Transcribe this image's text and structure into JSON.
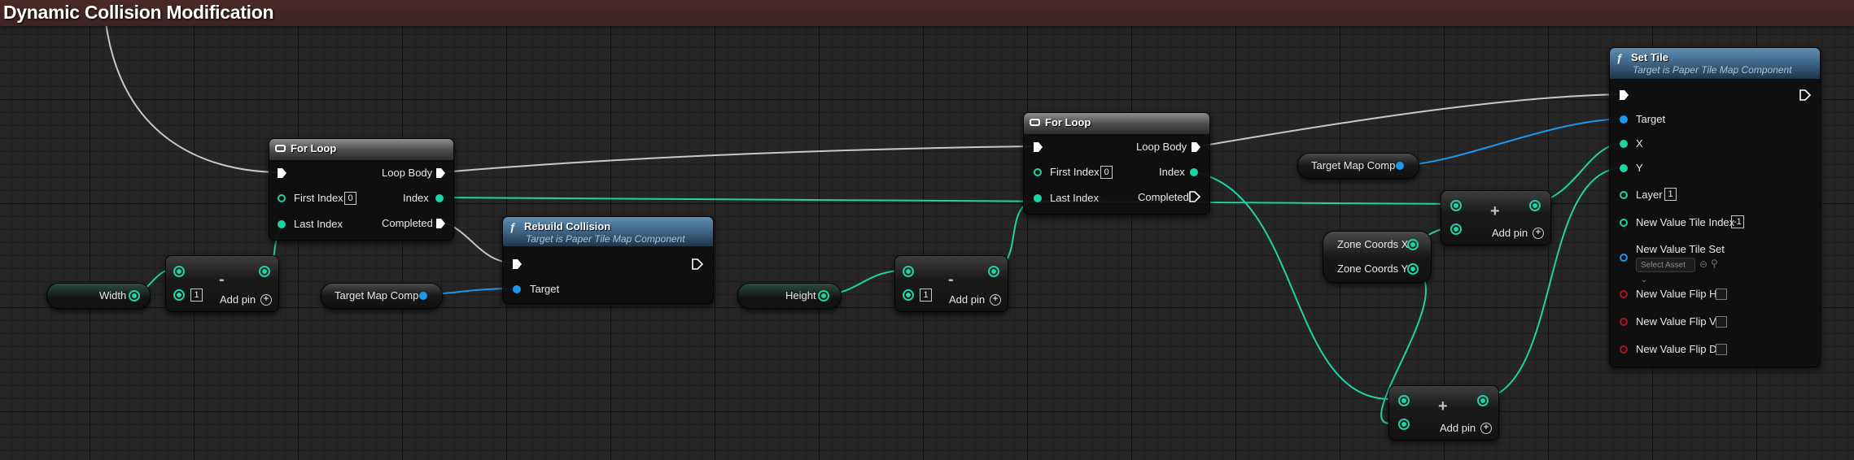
{
  "graph": {
    "title": "Dynamic Collision Modification"
  },
  "nodes": {
    "width_var": {
      "label": "Width"
    },
    "height_var": {
      "label": "Height"
    },
    "target_map_comp_1": {
      "label": "Target Map Comp"
    },
    "target_map_comp_2": {
      "label": "Target Map Comp"
    },
    "zone_coords": {
      "x_label": "Zone Coords X",
      "y_label": "Zone Coords Y"
    },
    "subtract_1": {
      "symbol": "-",
      "value": "1",
      "add_pin": "Add pin"
    },
    "subtract_2": {
      "symbol": "-",
      "value": "1",
      "add_pin": "Add pin"
    },
    "add_1": {
      "symbol": "+",
      "add_pin": "Add pin"
    },
    "add_2": {
      "symbol": "+",
      "add_pin": "Add pin"
    },
    "for_loop_1": {
      "title": "For Loop",
      "loop_body": "Loop Body",
      "first_index": "First Index",
      "first_index_value": "0",
      "index": "Index",
      "last_index": "Last Index",
      "completed": "Completed"
    },
    "for_loop_2": {
      "title": "For Loop",
      "loop_body": "Loop Body",
      "first_index": "First Index",
      "first_index_value": "0",
      "index": "Index",
      "last_index": "Last Index",
      "completed": "Completed"
    },
    "rebuild_collision": {
      "title": "Rebuild Collision",
      "subtitle": "Target is Paper Tile Map Component",
      "target": "Target"
    },
    "set_tile": {
      "title": "Set Tile",
      "subtitle": "Target is Paper Tile Map Component",
      "target": "Target",
      "x": "X",
      "y": "Y",
      "layer": "Layer",
      "layer_value": "1",
      "tile_index": "New Value Tile Index",
      "tile_index_value": "-1",
      "tile_set": "New Value Tile Set",
      "select_asset": "Select Asset",
      "flip_h": "New Value Flip H",
      "flip_v": "New Value Flip V",
      "flip_d": "New Value Flip D"
    }
  },
  "colors": {
    "exec": "#ffffff",
    "integer": "#1fd3a4",
    "object": "#1c97ec",
    "boolean": "#a8161a",
    "header_bar": "#4a2a26",
    "function_header": "#3a5f80"
  },
  "icons": [
    "loop-icon",
    "function-icon",
    "exec-pin-icon",
    "add-pin-icon",
    "search-icon",
    "browse-icon"
  ]
}
